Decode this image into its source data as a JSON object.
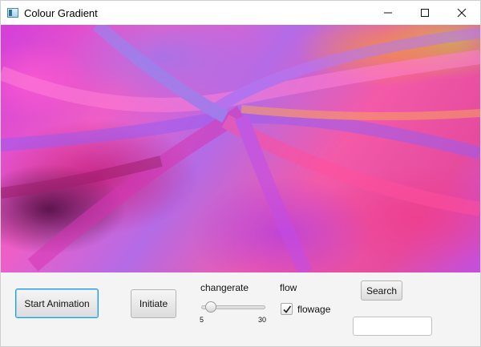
{
  "window": {
    "title": "Colour Gradient",
    "controls": [
      "minimize-icon",
      "maximize-icon",
      "close-icon"
    ]
  },
  "canvas": {
    "icon": "gradient-texture"
  },
  "controls": {
    "start_animation_label": "Start Animation",
    "initiate_label": "Initiate",
    "changerate": {
      "label": "changerate",
      "min_label": "5",
      "max_label": "30",
      "value": 7
    },
    "flow": {
      "label": "flow",
      "checkbox_label": "flowage",
      "checked": true
    },
    "search": {
      "button_label": "Search",
      "field_value": ""
    }
  },
  "colors": {
    "focus_border": "#1e9be0",
    "canvas_primary": "#ef5ec6",
    "canvas_secondary": "#b46be6"
  }
}
